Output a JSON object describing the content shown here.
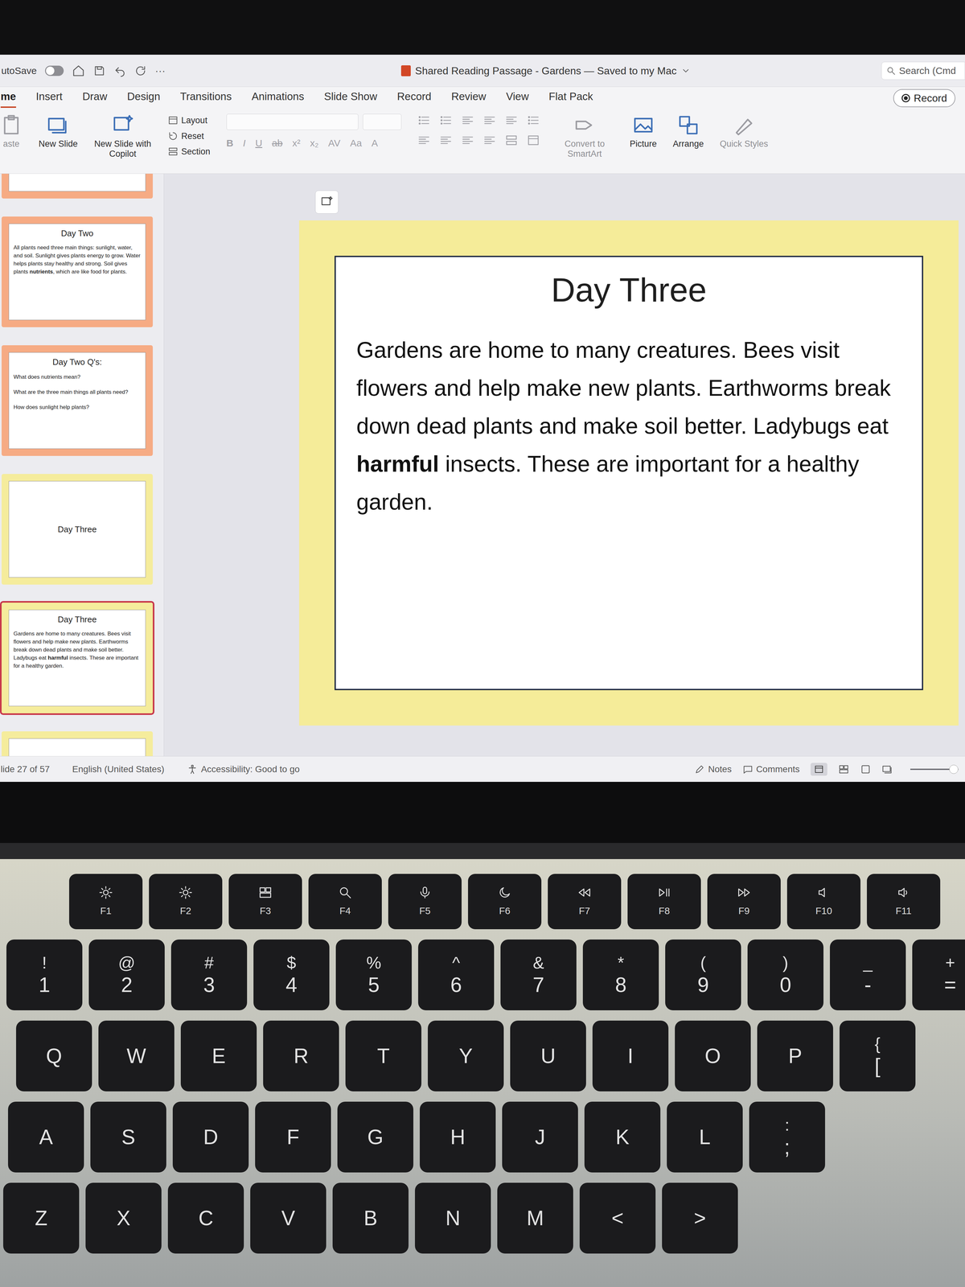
{
  "window": {
    "autosave_label": "utoSave",
    "autosave_on": false,
    "more": "···",
    "title": "Shared Reading Passage - Gardens — Saved to my Mac",
    "search": "Search (Cmd"
  },
  "tabs": [
    {
      "label": "me",
      "selected": true
    },
    {
      "label": "Insert",
      "selected": false
    },
    {
      "label": "Draw",
      "selected": false
    },
    {
      "label": "Design",
      "selected": false
    },
    {
      "label": "Transitions",
      "selected": false
    },
    {
      "label": "Animations",
      "selected": false
    },
    {
      "label": "Slide Show",
      "selected": false
    },
    {
      "label": "Record",
      "selected": false
    },
    {
      "label": "Review",
      "selected": false
    },
    {
      "label": "View",
      "selected": false
    },
    {
      "label": "Flat Pack",
      "selected": false
    }
  ],
  "record_button": "Record",
  "ribbon": [
    {
      "kind": "large",
      "label": "aste",
      "disabled": true
    },
    {
      "kind": "large",
      "label": "New Slide",
      "disabled": false
    },
    {
      "kind": "large",
      "label": "New Slide with Copilot",
      "disabled": false
    },
    {
      "kind": "stack",
      "items": [
        "Layout",
        "Reset",
        "Section"
      ]
    },
    {
      "kind": "font",
      "disabled": true,
      "buttons": [
        "B",
        "I",
        "U",
        "ab",
        "x²",
        "x₂",
        "AV",
        "Aa",
        "A"
      ]
    },
    {
      "kind": "paragraph"
    },
    {
      "kind": "large",
      "label": "Convert to SmartArt",
      "disabled": true
    },
    {
      "kind": "large",
      "label": "Picture",
      "disabled": false
    },
    {
      "kind": "large",
      "label": "Arrange",
      "disabled": false
    },
    {
      "kind": "large",
      "label": "Quick Styles",
      "disabled": true
    }
  ],
  "thumbnails": [
    {
      "kind": "blank",
      "color": "#f6ab84",
      "selected": false
    },
    {
      "kind": "text",
      "title": "Day Two",
      "color": "#f6ab84",
      "selected": false,
      "runs": [
        {
          "text": "All plants need three main things: sunlight, water, and soil. Sunlight gives plants energy to grow. Water helps plants stay healthy and strong. Soil gives plants ",
          "bold": false
        },
        {
          "text": "nutrients",
          "bold": true
        },
        {
          "text": ", which are like food for plants.",
          "bold": false
        }
      ]
    },
    {
      "kind": "questions",
      "title": "Day Two Q's:",
      "color": "#f6ab84",
      "selected": false,
      "questions": [
        "What does nutrients mean?",
        "What are the three main things all plants need?",
        "How does sunlight help plants?"
      ]
    },
    {
      "kind": "title",
      "title": "Day Three",
      "color": "#f5ec9c",
      "selected": false
    },
    {
      "kind": "text",
      "title": "Day Three",
      "color": "#f5ec9c",
      "selected": true,
      "runs": [
        {
          "text": "Gardens are home to many creatures. Bees visit flowers and help make new plants. Earthworms break down dead plants and make soil better. Ladybugs eat ",
          "bold": false
        },
        {
          "text": "harmful",
          "bold": true
        },
        {
          "text": " insects. These are important for a healthy garden.",
          "bold": false
        }
      ]
    },
    {
      "kind": "blank",
      "color": "#f5ec9c",
      "selected": false
    }
  ],
  "slide": {
    "title": "Day Three",
    "runs": [
      {
        "text": "Gardens are home to many creatures. Bees visit flowers and help make new plants. Earthworms break down dead plants and make soil better. Ladybugs eat ",
        "bold": false
      },
      {
        "text": "harmful",
        "bold": true
      },
      {
        "text": " insects. These are important for a healthy garden.",
        "bold": false
      }
    ]
  },
  "status_bar": {
    "slide": "lide 27 of 57",
    "language": "English (United States)",
    "accessibility": "Accessibility: Good to go",
    "notes": "Notes",
    "comments": "Comments",
    "zoom_level": 0.9
  },
  "keyboard": {
    "rows": [
      {
        "kind": "function",
        "keys": [
          {
            "label": "F1"
          },
          {
            "label": "F2"
          },
          {
            "label": "F3"
          },
          {
            "label": "F4"
          },
          {
            "label": "F5"
          },
          {
            "label": "F6"
          },
          {
            "label": "F7"
          },
          {
            "label": "F8"
          },
          {
            "label": "F9"
          },
          {
            "label": "F10"
          },
          {
            "label": "F11"
          }
        ]
      },
      {
        "kind": "number",
        "keys": [
          {
            "top": "!",
            "label": "1"
          },
          {
            "top": "@",
            "label": "2"
          },
          {
            "top": "#",
            "label": "3"
          },
          {
            "top": "$",
            "label": "4"
          },
          {
            "top": "%",
            "label": "5"
          },
          {
            "top": "^",
            "label": "6"
          },
          {
            "top": "&",
            "label": "7"
          },
          {
            "top": "*",
            "label": "8"
          },
          {
            "top": "(",
            "label": "9"
          },
          {
            "top": ")",
            "label": "0"
          },
          {
            "top": "_",
            "label": "-"
          },
          {
            "top": "+",
            "label": "="
          }
        ]
      },
      {
        "kind": "letter",
        "keys": [
          {
            "label": "Q"
          },
          {
            "label": "W"
          },
          {
            "label": "E"
          },
          {
            "label": "R"
          },
          {
            "label": "T"
          },
          {
            "label": "Y"
          },
          {
            "label": "U"
          },
          {
            "label": "I"
          },
          {
            "label": "O"
          },
          {
            "label": "P"
          },
          {
            "top": "{",
            "label": "["
          }
        ]
      },
      {
        "kind": "letter",
        "keys": [
          {
            "label": "A"
          },
          {
            "label": "S"
          },
          {
            "label": "D"
          },
          {
            "label": "F"
          },
          {
            "label": "G"
          },
          {
            "label": "H"
          },
          {
            "label": "J"
          },
          {
            "label": "K"
          },
          {
            "label": "L"
          },
          {
            "top": ":",
            "label": ";"
          }
        ]
      },
      {
        "kind": "letter",
        "keys": [
          {
            "label": "Z"
          },
          {
            "label": "X"
          },
          {
            "label": "C"
          },
          {
            "label": "V"
          },
          {
            "label": "B"
          },
          {
            "label": "N"
          },
          {
            "label": "M"
          },
          {
            "label": "<"
          },
          {
            "label": ">"
          }
        ]
      }
    ]
  }
}
